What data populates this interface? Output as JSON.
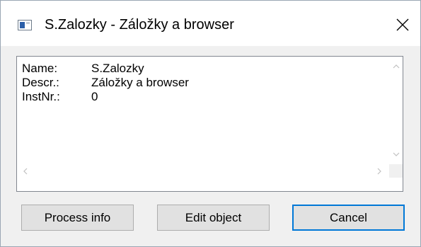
{
  "window": {
    "title": "S.Zalozky - Záložky a browser"
  },
  "info": {
    "rows": [
      {
        "key": "Name:",
        "value": "S.Zalozky"
      },
      {
        "key": "Descr.:",
        "value": "Záložky a browser"
      },
      {
        "key": "InstNr.:",
        "value": "0"
      }
    ]
  },
  "buttons": {
    "process_info": "Process info",
    "edit_object": "Edit object",
    "cancel": "Cancel"
  },
  "colors": {
    "accent": "#0078d7",
    "button_face": "#e1e1e1",
    "window_bg": "#f0f0f0"
  }
}
